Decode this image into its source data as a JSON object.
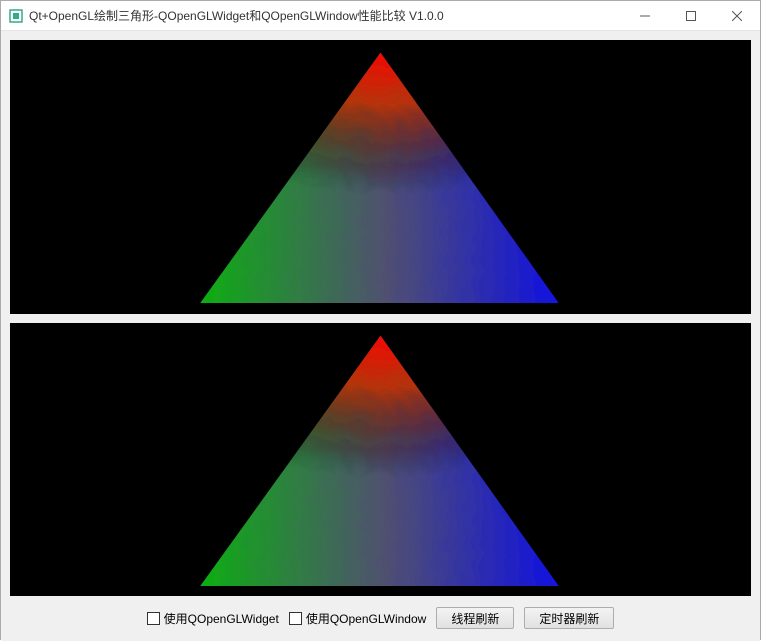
{
  "window": {
    "title": "Qt+OpenGL绘制三角形-QOpenGLWidget和QOpenGLWindow性能比较 V1.0.0"
  },
  "controls": {
    "checkbox1_label": "使用QOpenGLWidget",
    "checkbox2_label": "使用QOpenGLWindow",
    "button1_label": "线程刷新",
    "button2_label": "定时器刷新"
  }
}
